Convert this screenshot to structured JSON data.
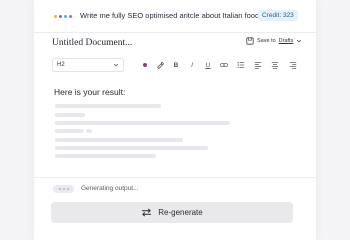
{
  "prompt": {
    "text": "Write me fully SEO optimised aritcle about Italian food",
    "dot_colors": [
      "#f0b23a",
      "#8a5cd6",
      "#3fb6e8",
      "#e25a5a"
    ]
  },
  "credit": {
    "label": "Credit: 323"
  },
  "document": {
    "title": "Untitled Document..."
  },
  "save": {
    "prefix": "Save to",
    "target": "Drafts"
  },
  "toolbar": {
    "heading_select": "H2",
    "icons": [
      "color-dot",
      "highlighter",
      "bold",
      "italic",
      "underline",
      "link",
      "bullet-list",
      "align-left",
      "align-center",
      "align-right"
    ],
    "bold": "B",
    "italic": "I",
    "underline": "U",
    "accent_color": "#7a3fa8"
  },
  "result": {
    "heading": "Here is your result:"
  },
  "status": {
    "text": "Generating output..."
  },
  "regenerate": {
    "label": "Re-generate"
  }
}
